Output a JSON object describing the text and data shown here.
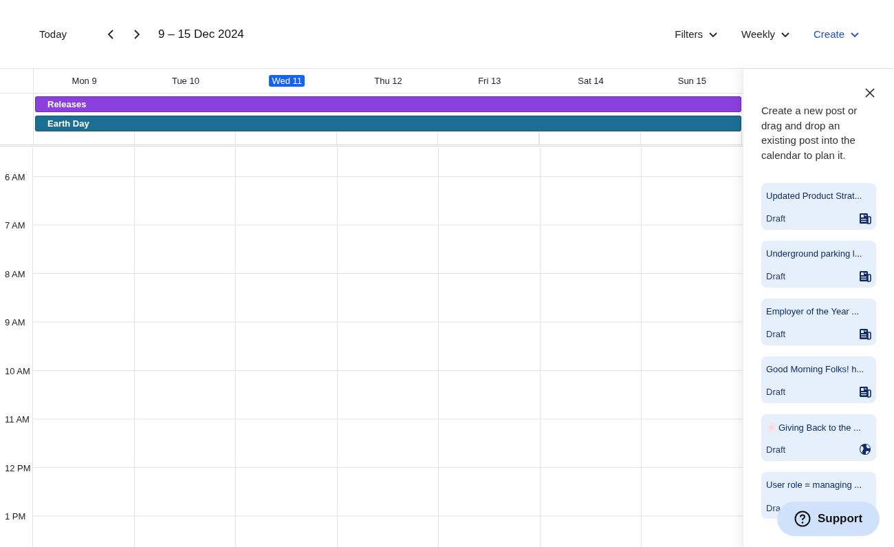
{
  "toolbar": {
    "today_button": "Today",
    "date_range": "9 – 15 Dec 2024",
    "menus": [
      {
        "label": "Filters",
        "kind": "plain"
      },
      {
        "label": "Weekly",
        "kind": "plain"
      },
      {
        "label": "Create",
        "kind": "primary"
      }
    ]
  },
  "days": [
    {
      "label": "Mon 9",
      "selected": false
    },
    {
      "label": "Tue 10",
      "selected": false
    },
    {
      "label": "Wed 11",
      "selected": true
    },
    {
      "label": "Thu 12",
      "selected": false
    },
    {
      "label": "Fri 13",
      "selected": false
    },
    {
      "label": "Sat 14",
      "selected": false
    },
    {
      "label": "Sun 15",
      "selected": false
    }
  ],
  "all_day_events": [
    {
      "title": "Releases",
      "color": "#8b3fdc"
    },
    {
      "title": "Earth Day",
      "color": "#1c6f93"
    }
  ],
  "hours": [
    "6 AM",
    "7 AM",
    "8 AM",
    "9 AM",
    "10 AM",
    "11 AM",
    "12 PM",
    "1 PM"
  ],
  "panel": {
    "intro": "Create a new post or drag and drop an existing post into the calendar to plan it.",
    "posts": [
      {
        "title": "Updated Product Strat...",
        "status": "Draft",
        "kind": "article"
      },
      {
        "title": "Underground parking l...",
        "status": "Draft",
        "kind": "article"
      },
      {
        "title": "Employer of the Year ...",
        "status": "Draft",
        "kind": "article"
      },
      {
        "title": "Good Morning Folks! h...",
        "status": "Draft",
        "kind": "article"
      },
      {
        "title": "Giving Back to the ...",
        "status": "Draft",
        "kind": "globe",
        "thumbnail": true
      },
      {
        "title": "User role = managing ...",
        "status": "Dra",
        "kind": "hidden"
      }
    ]
  },
  "support_button": "Support"
}
